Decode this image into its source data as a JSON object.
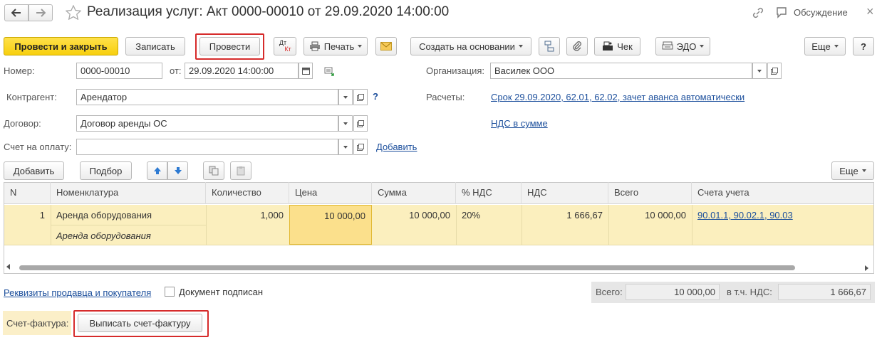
{
  "window": {
    "title": "Реализация услуг: Акт 0000-00010 от 29.09.2020 14:00:00",
    "discussion_label": "Обсуждение"
  },
  "toolbar": {
    "post_close_label": "Провести и закрыть",
    "save_label": "Записать",
    "post_label": "Провести",
    "dt_kt_label_dt": "Дт",
    "dt_kt_label_kt": "Кт",
    "print_label": "Печать",
    "create_basis_label": "Создать на основании",
    "receipt_label": "Чек",
    "edo_label": "ЭДО",
    "more_label": "Еще",
    "help_label": "?"
  },
  "form": {
    "number_label": "Номер:",
    "number_value": "0000-00010",
    "date_label": "от:",
    "date_value": "29.09.2020 14:00:00",
    "org_label": "Организация:",
    "org_value": "Василек ООО",
    "counterparty_label": "Контрагент:",
    "counterparty_value": "Арендатор",
    "question_mark": "?",
    "settlements_label": "Расчеты:",
    "settlements_link": "Срок 29.09.2020, 62.01, 62.02, зачет аванса автоматически",
    "contract_label": "Договор:",
    "contract_value": "Договор аренды ОС",
    "vat_link": "НДС в сумме",
    "invoice_label": "Счет на оплату:",
    "invoice_value": "",
    "add_link": "Добавить"
  },
  "table_toolbar": {
    "add_label": "Добавить",
    "pick_label": "Подбор",
    "more_label": "Еще"
  },
  "table": {
    "headers": [
      "N",
      "Номенклатура",
      "Количество",
      "Цена",
      "Сумма",
      "% НДС",
      "НДС",
      "Всего",
      "Счета учета"
    ],
    "rows": [
      {
        "n": "1",
        "item": "Аренда оборудования",
        "item_content": "Аренда оборудования",
        "qty": "1,000",
        "price": "10 000,00",
        "sum": "10 000,00",
        "vat_rate": "20%",
        "vat": "1 666,67",
        "total": "10 000,00",
        "accounts": "90.01.1, 90.02.1, 90.03"
      }
    ]
  },
  "footer": {
    "requisites_link": "Реквизиты продавца и покупателя",
    "signed_label": "Документ подписан",
    "signed_checked": false,
    "total_label": "Всего:",
    "total_value": "10 000,00",
    "vat_incl_label": "в т.ч. НДС:",
    "vat_incl_value": "1 666,67",
    "invoice_label": "Счет-фактура:",
    "issue_invoice_label": "Выписать счет-фактуру"
  },
  "colors": {
    "accent_yellow": "#f7cf0e",
    "row_highlight": "#fbefbe",
    "cell_selected": "#fbe08c",
    "link": "#1c4f9c",
    "red_frame": "#d62b2b",
    "invoice_bar": "#fbefc8"
  }
}
